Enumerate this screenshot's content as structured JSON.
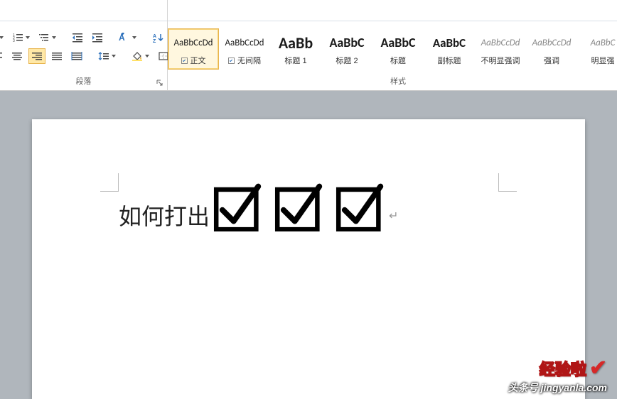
{
  "ribbon": {
    "paragraph": {
      "label": "段落"
    },
    "styles": {
      "label": "样式",
      "items": [
        {
          "preview": "AaBbCcDd",
          "name": "正文",
          "size": "13px",
          "weight": "normal",
          "italic": false,
          "selected": true,
          "indicator": true
        },
        {
          "preview": "AaBbCcDd",
          "name": "无间隔",
          "size": "13px",
          "weight": "normal",
          "italic": false,
          "selected": false,
          "indicator": true
        },
        {
          "preview": "AaBb",
          "name": "标题 1",
          "size": "22px",
          "weight": "bold",
          "italic": false,
          "selected": false,
          "indicator": false
        },
        {
          "preview": "AaBbC",
          "name": "标题 2",
          "size": "18px",
          "weight": "bold",
          "italic": false,
          "selected": false,
          "indicator": false
        },
        {
          "preview": "AaBbC",
          "name": "标题",
          "size": "18px",
          "weight": "bold",
          "italic": false,
          "selected": false,
          "indicator": false
        },
        {
          "preview": "AaBbC",
          "name": "副标题",
          "size": "17px",
          "weight": "bold",
          "italic": false,
          "selected": false,
          "indicator": false
        },
        {
          "preview": "AaBbCcDd",
          "name": "不明显强调",
          "size": "13px",
          "weight": "normal",
          "italic": true,
          "selected": false,
          "indicator": false
        },
        {
          "preview": "AaBbCcDd",
          "name": "强调",
          "size": "13px",
          "weight": "normal",
          "italic": true,
          "selected": false,
          "indicator": false
        },
        {
          "preview": "AaBbC",
          "name": "明显强",
          "size": "13px",
          "weight": "normal",
          "italic": true,
          "selected": false,
          "indicator": false
        }
      ]
    }
  },
  "document": {
    "text": "如何打出",
    "checkbox_count": 3
  },
  "watermark": {
    "line1": "经验啦",
    "line2": "头条号 jingyanla.com"
  }
}
